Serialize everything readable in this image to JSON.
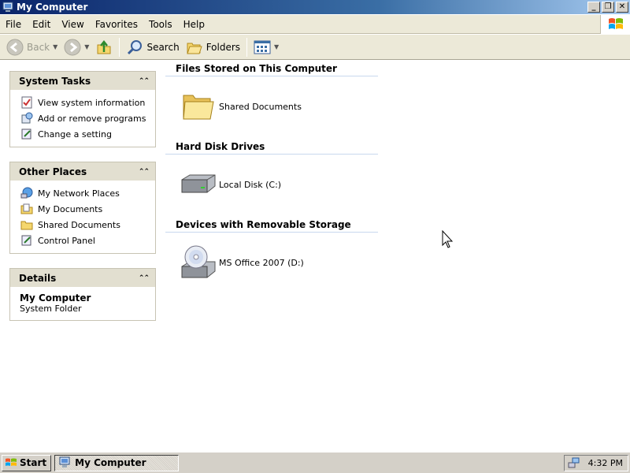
{
  "window": {
    "title": "My Computer",
    "buttons": {
      "minimize": "_",
      "restore": "❐",
      "close": "✕"
    }
  },
  "menu": [
    "File",
    "Edit",
    "View",
    "Favorites",
    "Tools",
    "Help"
  ],
  "toolbar": {
    "back_label": "Back",
    "search_label": "Search",
    "folders_label": "Folders"
  },
  "sidebar": {
    "system_tasks": {
      "title": "System Tasks",
      "items": [
        "View system information",
        "Add or remove programs",
        "Change a setting"
      ]
    },
    "other_places": {
      "title": "Other Places",
      "items": [
        "My Network Places",
        "My Documents",
        "Shared Documents",
        "Control Panel"
      ]
    },
    "details": {
      "title": "Details",
      "name": "My Computer",
      "type": "System Folder"
    }
  },
  "groups": [
    {
      "title": "Files Stored on This Computer",
      "items": [
        {
          "label": "Shared Documents",
          "icon": "folder-icon"
        }
      ]
    },
    {
      "title": "Hard Disk Drives",
      "items": [
        {
          "label": "Local Disk (C:)",
          "icon": "hard-disk-icon"
        }
      ]
    },
    {
      "title": "Devices with Removable Storage",
      "items": [
        {
          "label": "MS Office 2007 (D:)",
          "icon": "cd-drive-icon"
        }
      ]
    }
  ],
  "taskbar": {
    "start_label": "Start",
    "task_label": "My Computer",
    "clock": "4:32 PM"
  },
  "colors": {
    "titlebar": "#0a246a",
    "chrome": "#ece9d8",
    "panel_header": "#e2dfd0",
    "taskbar": "#d4d0c8"
  }
}
